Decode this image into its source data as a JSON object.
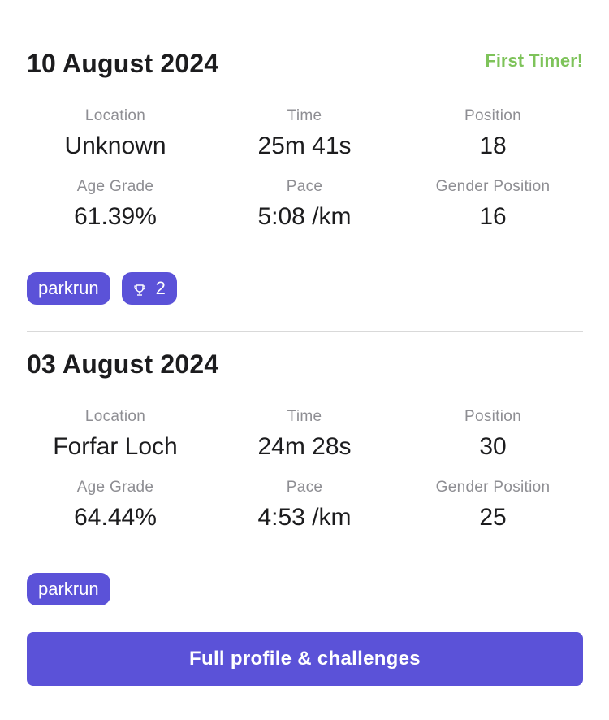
{
  "runs": [
    {
      "date": "10 August 2024",
      "badge": "First Timer!",
      "stats": {
        "location": {
          "label": "Location",
          "value": "Unknown"
        },
        "time": {
          "label": "Time",
          "value": "25m 41s"
        },
        "position": {
          "label": "Position",
          "value": "18"
        },
        "age_grade": {
          "label": "Age Grade",
          "value": "61.39%"
        },
        "pace": {
          "label": "Pace",
          "value": "5:08 /km"
        },
        "gender_position": {
          "label": "Gender Position",
          "value": "16"
        }
      },
      "tags": {
        "event": "parkrun",
        "trophy_count": "2"
      }
    },
    {
      "date": "03 August 2024",
      "stats": {
        "location": {
          "label": "Location",
          "value": "Forfar Loch"
        },
        "time": {
          "label": "Time",
          "value": "24m 28s"
        },
        "position": {
          "label": "Position",
          "value": "30"
        },
        "age_grade": {
          "label": "Age Grade",
          "value": "64.44%"
        },
        "pace": {
          "label": "Pace",
          "value": "4:53 /km"
        },
        "gender_position": {
          "label": "Gender Position",
          "value": "25"
        }
      },
      "tags": {
        "event": "parkrun"
      }
    }
  ],
  "cta": {
    "label": "Full profile & challenges"
  },
  "colors": {
    "accent": "#5b52d8",
    "badge_green": "#7ec35a",
    "label_gray": "#8e8e93"
  },
  "icons": {
    "trophy": "trophy-icon"
  }
}
